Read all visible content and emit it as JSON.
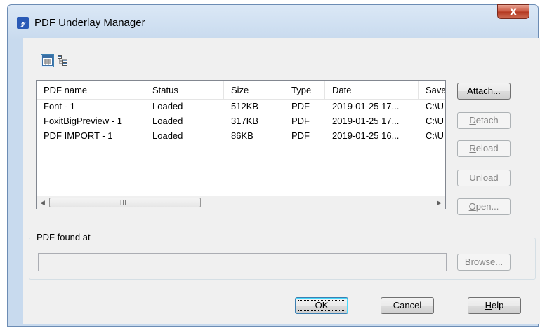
{
  "window": {
    "title": "PDF Underlay Manager",
    "close_glyph": "x",
    "app_icon_glyph": "𝓏"
  },
  "toolbar": {
    "list_view_icon": "list-view-icon",
    "tree_view_icon": "tree-view-icon"
  },
  "list": {
    "columns": [
      "PDF name",
      "Status",
      "Size",
      "Type",
      "Date",
      "Save"
    ],
    "rows": [
      [
        "Font - 1",
        "Loaded",
        "512KB",
        "PDF",
        "2019-01-25 17...",
        "C:\\U"
      ],
      [
        "FoxitBigPreview - 1",
        "Loaded",
        "317KB",
        "PDF",
        "2019-01-25 17...",
        "C:\\U"
      ],
      [
        "PDF IMPORT - 1",
        "Loaded",
        "86KB",
        "PDF",
        "2019-01-25 16...",
        "C:\\U"
      ]
    ],
    "scroll_left_glyph": "◀",
    "scroll_right_glyph": "▶",
    "scroll_grip": "III"
  },
  "side_buttons": {
    "attach": {
      "mnemonic": "A",
      "rest": "ttach..."
    },
    "detach": {
      "mnemonic": "D",
      "rest": "etach"
    },
    "reload": {
      "mnemonic": "R",
      "rest": "eload"
    },
    "unload": {
      "mnemonic": "U",
      "rest": "nload"
    },
    "open": {
      "mnemonic": "O",
      "rest": "pen..."
    }
  },
  "found_at": {
    "label": "PDF found at",
    "value": "",
    "browse": {
      "mnemonic": "B",
      "rest": "rowse..."
    }
  },
  "footer": {
    "ok": "OK",
    "cancel": "Cancel",
    "help": {
      "mnemonic": "H",
      "rest": "elp"
    }
  }
}
